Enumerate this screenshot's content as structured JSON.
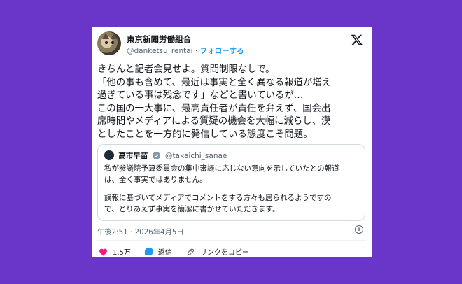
{
  "author": {
    "name": "東京新聞労働組合",
    "handle": "@danketsu_rentai",
    "separator": "·",
    "follow_label": "フォローする"
  },
  "x_logo": "x-logo-icon",
  "body_lines": [
    "きちんと記者会見せよ。質問制限なしで。",
    "「他の事も含めて、最近は事実と全く異なる報道が増え",
    "過ぎている事は残念です」などと書いているが…",
    "この国の一大事に、最高責任者が責任を弁えず、国会出",
    "席時間やメディアによる質疑の機会を大幅に減らし、漠",
    "としたことを一方的に発信している態度こそ問題。"
  ],
  "quote": {
    "name": "高市早苗",
    "handle": "@takaichi_sanae",
    "lines": [
      "私が参議院予算委員会の集中審議に応じない意向を示していたとの報道",
      "は、全く事実ではありません。",
      "",
      "誤報に基づいてメディアでコメントをする方々も居られるようですの",
      "で、とりあえず事実を簡潔に書かせていただきます。"
    ]
  },
  "meta": {
    "timestamp": "午後2:51 · 2026年4月5日"
  },
  "actions": {
    "likes": "1.5万",
    "reply_label": "返信",
    "copy_link_label": "リンクをコピー"
  },
  "colors": {
    "background": "#6a35c9",
    "accent": "#1d9bf0",
    "like": "#f91880"
  }
}
